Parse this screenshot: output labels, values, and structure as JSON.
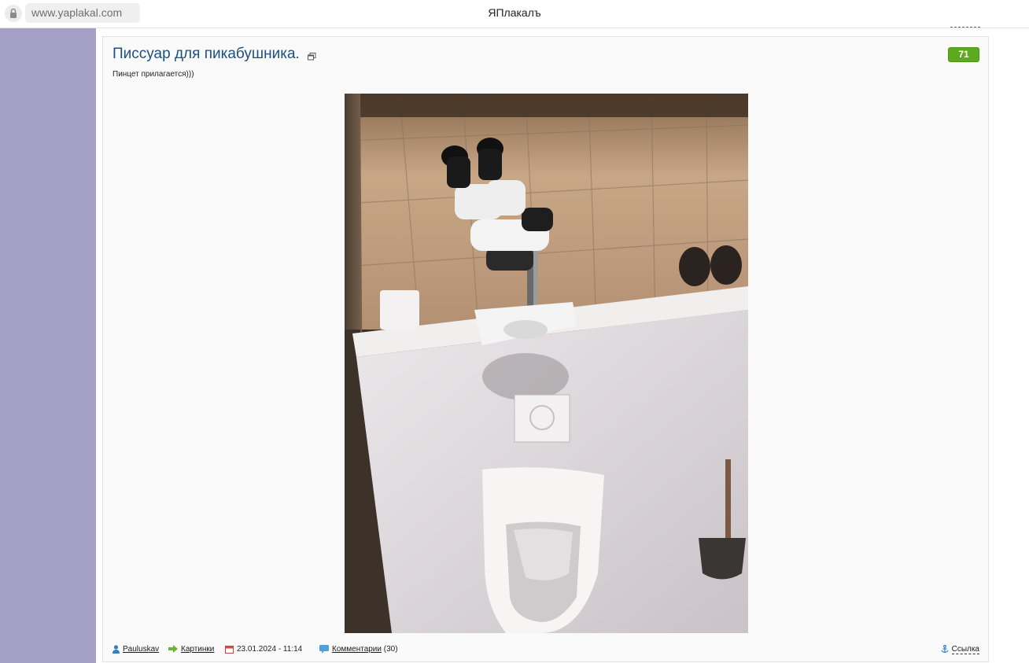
{
  "browser": {
    "url": "www.yaplakal.com",
    "title": "ЯПлакалъ"
  },
  "post": {
    "title": "Писсуар для пикабушника.",
    "rating": "71",
    "description": "Пинцет прилагается)))",
    "image_alt_icon": "photo-microscope-urinal"
  },
  "footer": {
    "author": "Pauluskav",
    "category": "Картинки",
    "date": "23.01.2024 - 11:14",
    "comments_label": "Комментарии",
    "comments_count": "(30)",
    "link_label": "Ссылка"
  },
  "colors": {
    "sidebar": "#a5a0c6",
    "title_link": "#1e4f7e",
    "rating_badge": "#5caa1e"
  }
}
